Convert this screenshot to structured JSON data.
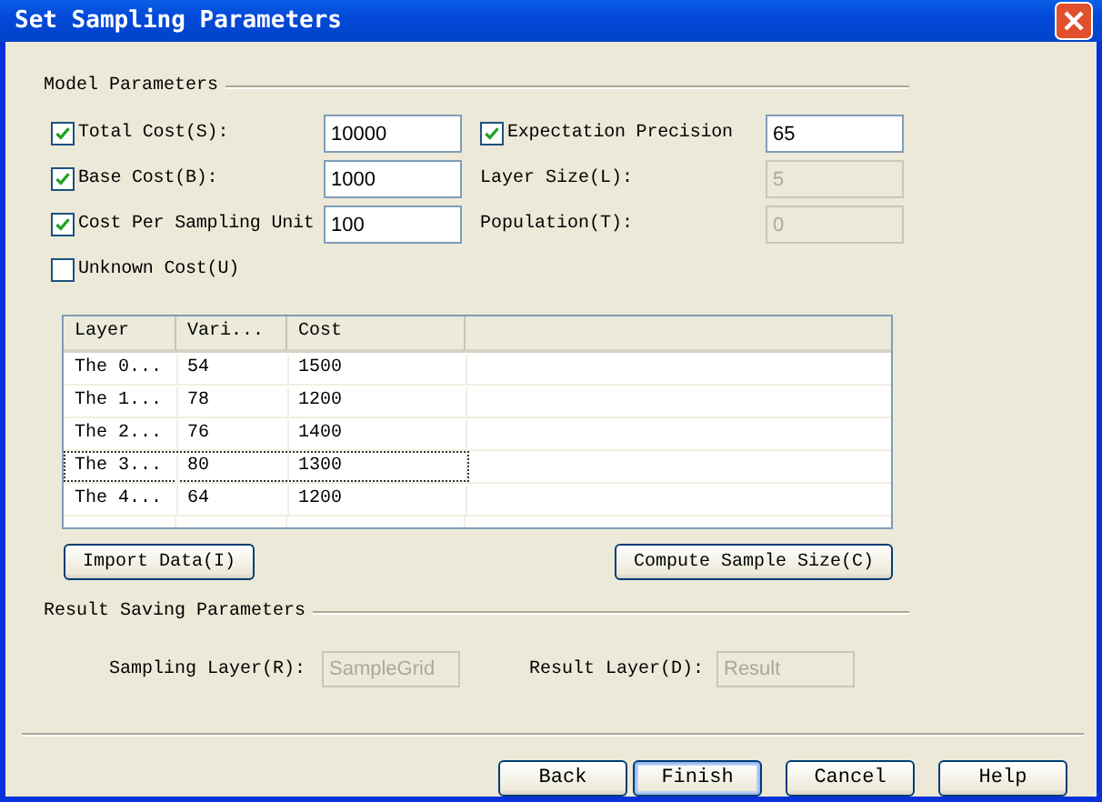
{
  "window": {
    "title": "Set Sampling Parameters"
  },
  "model_parameters": {
    "title": "Model Parameters",
    "fields": [
      {
        "kind": "checkbox",
        "label": "Total Cost(S):",
        "checked": true,
        "value": "10000",
        "disabled": false
      },
      {
        "kind": "checkbox",
        "label": "Expectation Precision",
        "checked": true,
        "value": "65",
        "disabled": false
      },
      {
        "kind": "checkbox",
        "label": "Base Cost(B):",
        "checked": true,
        "value": "1000",
        "disabled": false
      },
      {
        "kind": "label",
        "label": "Layer Size(L):",
        "value": "5",
        "disabled": true
      },
      {
        "kind": "checkbox",
        "label": "Cost Per Sampling Unit",
        "checked": true,
        "value": "100",
        "disabled": false
      },
      {
        "kind": "label",
        "label": "Population(T):",
        "value": "0",
        "disabled": true
      },
      {
        "kind": "checkbox",
        "label": "Unknown Cost(U)",
        "checked": false
      }
    ]
  },
  "table": {
    "columns": [
      "Layer",
      "Vari...",
      "Cost"
    ],
    "rows": [
      {
        "cells": [
          "The 0...",
          "54",
          "1500"
        ],
        "focused": false
      },
      {
        "cells": [
          "The 1...",
          "78",
          "1200"
        ],
        "focused": false
      },
      {
        "cells": [
          "The 2...",
          "76",
          "1400"
        ],
        "focused": false
      },
      {
        "cells": [
          "The 3...",
          "80",
          "1300"
        ],
        "focused": true
      },
      {
        "cells": [
          "The 4...",
          "64",
          "1200"
        ],
        "focused": false
      }
    ]
  },
  "table_buttons": [
    "Import Data(I)",
    "Compute Sample Size(C)"
  ],
  "result_saving": {
    "title": "Result Saving Parameters",
    "fields": [
      {
        "label": "Sampling Layer(R):",
        "value": "SampleGrid",
        "disabled": true
      },
      {
        "label": "Result Layer(D):",
        "value": "Result",
        "disabled": true
      }
    ]
  },
  "buttons": [
    {
      "label": "Back",
      "default": false
    },
    {
      "label": "Finish",
      "default": true
    },
    {
      "label": "Cancel",
      "default": false
    },
    {
      "label": "Help",
      "default": false
    }
  ]
}
